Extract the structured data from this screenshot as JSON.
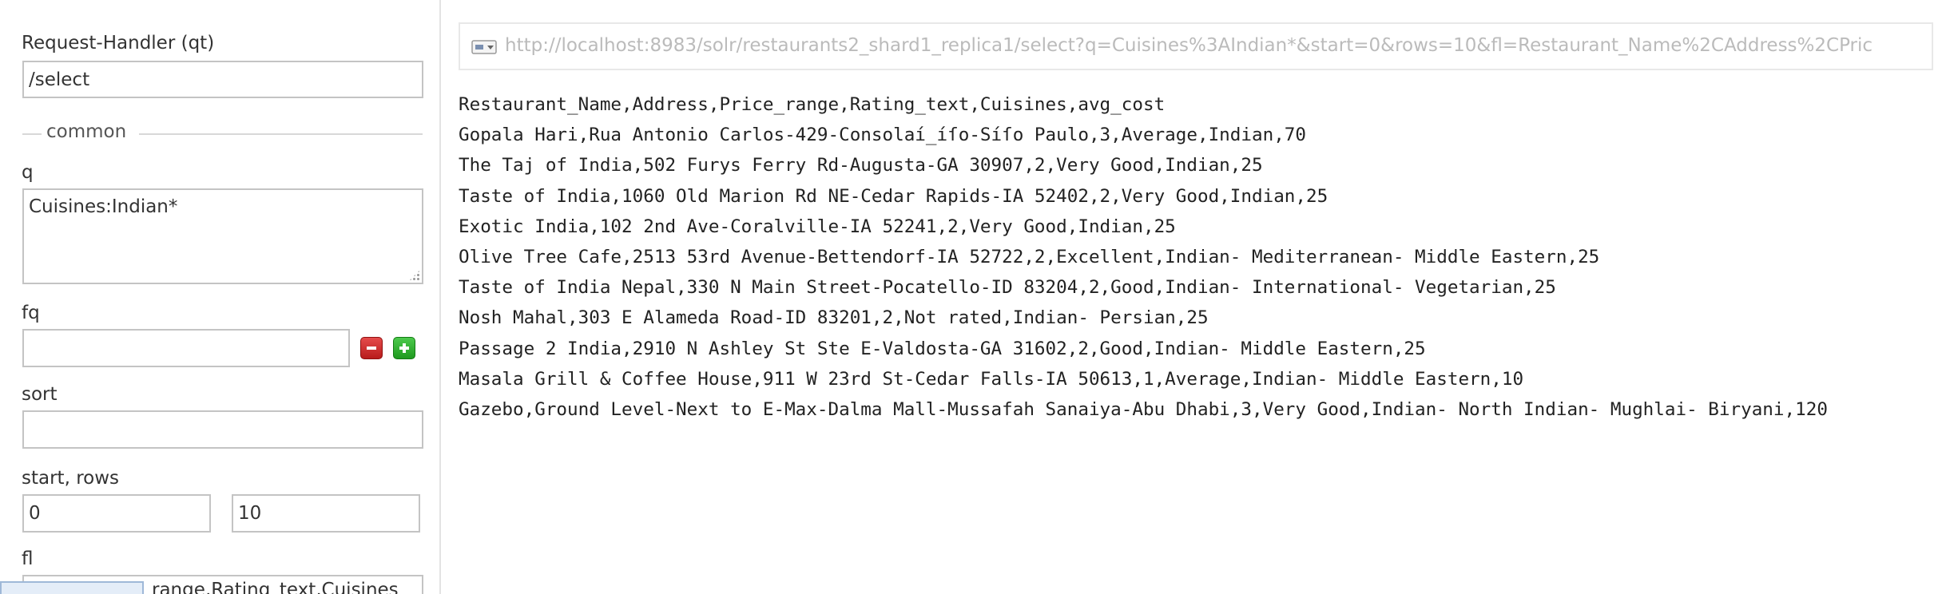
{
  "form": {
    "request_handler": {
      "label": "Request-Handler (qt)",
      "value": "/select"
    },
    "common_section": {
      "legend": "common"
    },
    "q": {
      "label": "q",
      "value": "Cuisines:Indian*"
    },
    "fq": {
      "label": "fq",
      "value": ""
    },
    "sort": {
      "label": "sort",
      "value": ""
    },
    "start_rows": {
      "label": "start, rows",
      "start_value": "0",
      "rows_value": "10"
    },
    "fl": {
      "label": "fl",
      "visible_fragment": "range,Rating_text,Cuisines"
    },
    "icons": {
      "remove": "minus-icon",
      "add": "plus-icon"
    }
  },
  "response": {
    "url": "http://localhost:8983/solr/restaurants2_shard1_replica1/select?q=Cuisines%3AIndian*&start=0&rows=10&fl=Restaurant_Name%2CAddress%2CPric",
    "url_icon": "request-url-icon",
    "lines": [
      "Restaurant_Name,Address,Price_range,Rating_text,Cuisines,avg_cost",
      "Gopala Hari,Rua Antonio Carlos-429-Consolaí_íſo-Síſo Paulo,3,Average,Indian,70",
      "The Taj of India,502 Furys Ferry Rd-Augusta-GA 30907,2,Very Good,Indian,25",
      "Taste of India,1060 Old Marion Rd NE-Cedar Rapids-IA 52402,2,Very Good,Indian,25",
      "Exotic India,102 2nd Ave-Coralville-IA 52241,2,Very Good,Indian,25",
      "Olive Tree Cafe,2513 53rd Avenue-Bettendorf-IA 52722,2,Excellent,Indian- Mediterranean- Middle Eastern,25",
      "Taste of India Nepal,330 N Main Street-Pocatello-ID 83204,2,Good,Indian- International- Vegetarian,25",
      "Nosh Mahal,303 E Alameda Road-ID 83201,2,Not rated,Indian- Persian,25",
      "Passage 2 India,2910 N Ashley St Ste E-Valdosta-GA 31602,2,Good,Indian- Middle Eastern,25",
      "Masala Grill & Coffee House,911 W 23rd St-Cedar Falls-IA 50613,1,Average,Indian- Middle Eastern,10",
      "Gazebo,Ground Level-Next to E-Max-Dalma Mall-Mussafah Sanaiya-Abu Dhabi,3,Very Good,Indian- North Indian- Mughlai- Biryani,120"
    ]
  },
  "colors": {
    "remove_button": "#d03030",
    "add_button": "#33b033",
    "input_border": "#c4c4c4",
    "url_text": "#bbbbbb",
    "panel_divider": "#e3e3e3"
  }
}
